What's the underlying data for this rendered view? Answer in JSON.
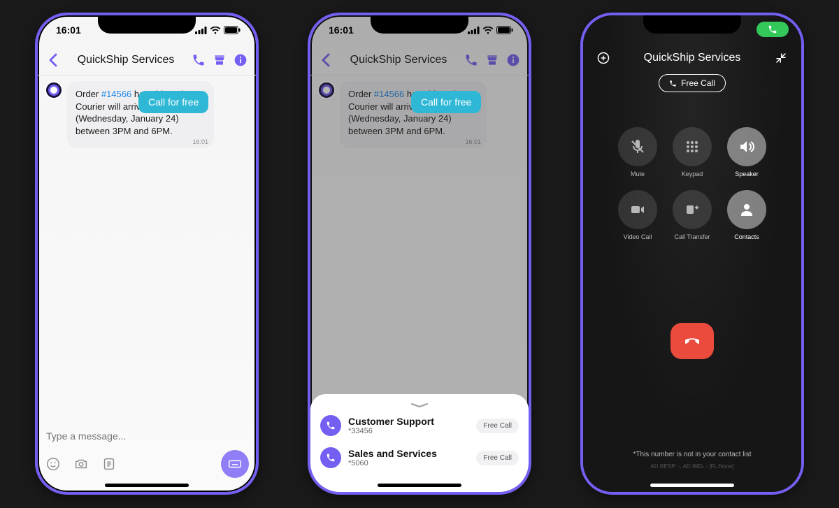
{
  "status": {
    "time": "16:01"
  },
  "chat": {
    "title": "QuickShip Services",
    "call_for_free": "Call for free",
    "msg_prefix": "Order ",
    "msg_order": "#14566",
    "msg_body": " has shipped. Courier will arrive tomorrow (Wednesday, January 24) between 3PM and 6PM.",
    "msg_ts": "16:01",
    "placeholder": "Type a message..."
  },
  "sheet": {
    "items": [
      {
        "name": "Customer Support",
        "num": "*33456",
        "action": "Free Call"
      },
      {
        "name": "Sales and Services",
        "num": "*5060",
        "action": "Free Call"
      }
    ]
  },
  "call": {
    "title": "QuickShip Services",
    "type": "Free Call",
    "buttons": [
      {
        "label": "Mute"
      },
      {
        "label": "Keypad"
      },
      {
        "label": "Speaker"
      },
      {
        "label": "Video Call"
      },
      {
        "label": "Call Transfer"
      },
      {
        "label": "Contacts"
      }
    ],
    "footnote": "*This number is not in your contact list",
    "ad_meta": "AD RESP: -, AD IMG: - [FL:None]"
  }
}
